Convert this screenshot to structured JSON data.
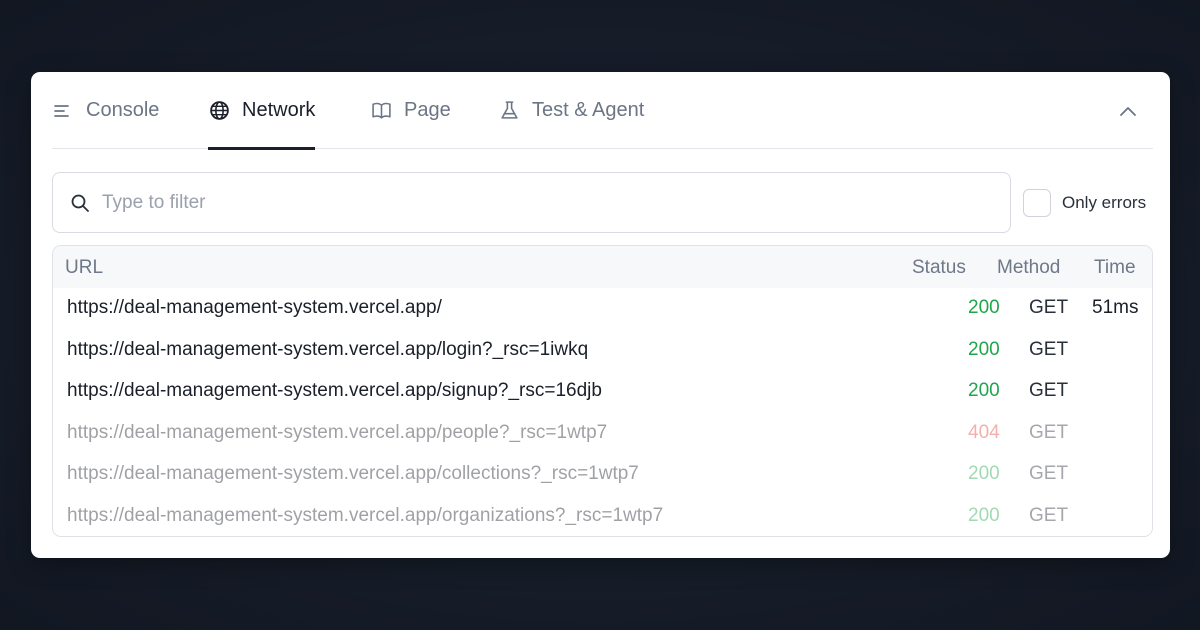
{
  "tabs": [
    {
      "label": "Console",
      "icon": "lines-icon",
      "active": false
    },
    {
      "label": "Network",
      "icon": "globe-icon",
      "active": true
    },
    {
      "label": "Page",
      "icon": "book-icon",
      "active": false
    },
    {
      "label": "Test & Agent",
      "icon": "flask-icon",
      "active": false
    }
  ],
  "filter": {
    "placeholder": "Type to filter",
    "value": ""
  },
  "only_errors": {
    "label": "Only errors",
    "checked": false
  },
  "table": {
    "headers": {
      "url": "URL",
      "status": "Status",
      "method": "Method",
      "time": "Time"
    },
    "rows": [
      {
        "url": "https://deal-management-system.vercel.app/",
        "status": "200",
        "method": "GET",
        "time": "51ms"
      },
      {
        "url": "https://deal-management-system.vercel.app/login?_rsc=1iwkq",
        "status": "200",
        "method": "GET",
        "time": ""
      },
      {
        "url": "https://deal-management-system.vercel.app/signup?_rsc=16djb",
        "status": "200",
        "method": "GET",
        "time": ""
      },
      {
        "url": "https://deal-management-system.vercel.app/people?_rsc=1wtp7",
        "status": "404",
        "method": "GET",
        "time": ""
      },
      {
        "url": "https://deal-management-system.vercel.app/collections?_rsc=1wtp7",
        "status": "200",
        "method": "GET",
        "time": ""
      },
      {
        "url": "https://deal-management-system.vercel.app/organizations?_rsc=1wtp7",
        "status": "200",
        "method": "GET",
        "time": ""
      }
    ]
  },
  "colors": {
    "status_ok": "#1fa64d",
    "status_error": "#e2463b",
    "active_tab": "#1a1f29"
  }
}
